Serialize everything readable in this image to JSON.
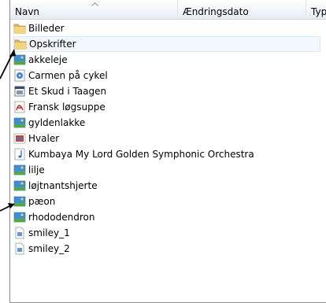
{
  "columns": {
    "name": "Navn",
    "date": "Ændringsdato",
    "type": "Typ"
  },
  "items": [
    {
      "label": "Billeder",
      "icon": "folder-icon"
    },
    {
      "label": "Opskrifter",
      "icon": "folder-icon"
    },
    {
      "label": "akkeleje",
      "icon": "image-icon"
    },
    {
      "label": "Carmen på cykel",
      "icon": "video-icon"
    },
    {
      "label": "Et Skud i Taagen",
      "icon": "film-icon"
    },
    {
      "label": "Fransk løgsuppe",
      "icon": "pdf-icon"
    },
    {
      "label": "gyldenlakke",
      "icon": "image-icon"
    },
    {
      "label": "Hvaler",
      "icon": "image-icon"
    },
    {
      "label": "Kumbaya My Lord Golden Symphonic Orchestra",
      "icon": "music-icon"
    },
    {
      "label": "lilje",
      "icon": "image-icon"
    },
    {
      "label": "løjtnantshjerte",
      "icon": "image-icon"
    },
    {
      "label": "pæon",
      "icon": "image-icon"
    },
    {
      "label": "rhododendron",
      "icon": "image-icon"
    },
    {
      "label": "smiley_1",
      "icon": "image-file-icon"
    },
    {
      "label": "smiley_2",
      "icon": "image-file-icon"
    }
  ],
  "selected_item": "Opskrifter",
  "colors": {
    "folder": "#e8b84a",
    "selection_bg": "#f2f8fd",
    "selection_border": "#d6e8f9"
  }
}
